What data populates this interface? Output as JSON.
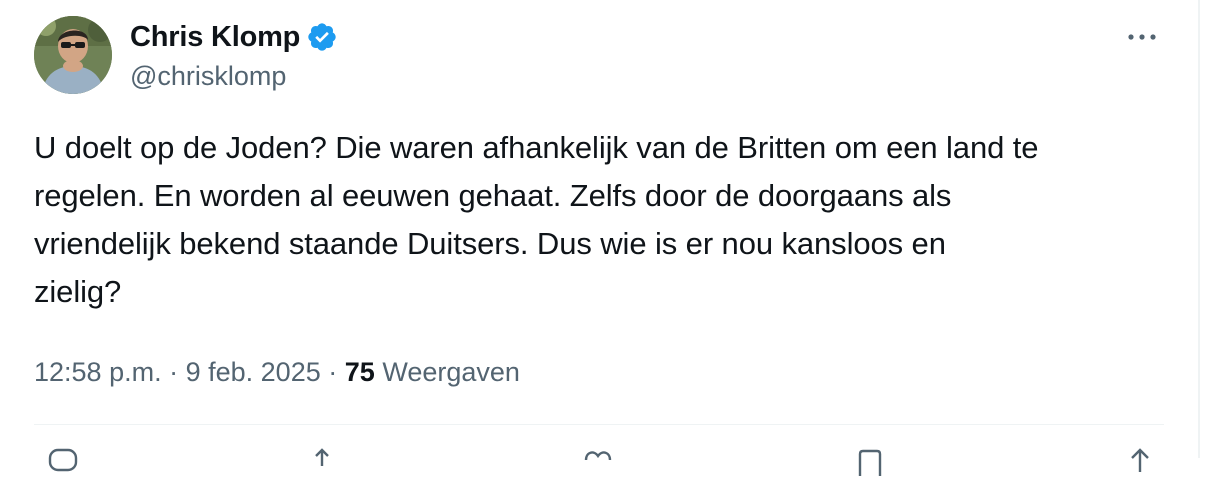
{
  "tweet": {
    "author": {
      "display_name": "Chris Klomp",
      "handle": "@chrisklomp",
      "verified": true
    },
    "text": "U doelt op de Joden? Die waren afhankelijk van de Britten om een land te\nregelen. En worden al eeuwen gehaat. Zelfs door de doorgaans als\nvriendelijk bekend staande Duitsers. Dus wie is er nou kansloos en\nzielig?",
    "time": "12:58 p.m.",
    "date": "9 feb. 2025",
    "separator": "·",
    "views_count": "75",
    "views_label": "Weergaven"
  },
  "icons": {
    "verified": "verified-badge-icon",
    "more": "more-options-icon",
    "actions": [
      "reply-icon",
      "retweet-icon",
      "like-icon",
      "bookmark-icon",
      "share-icon"
    ]
  },
  "colors": {
    "text_primary": "#0f1419",
    "text_secondary": "#536471",
    "verified_blue": "#1d9bf0",
    "divider": "#eff3f4"
  }
}
